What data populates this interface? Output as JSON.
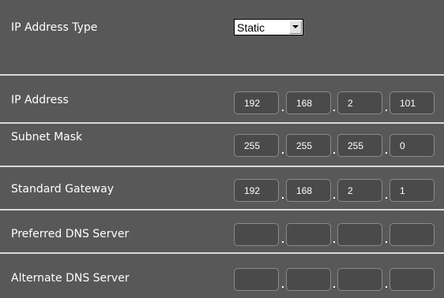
{
  "ip_address_type": {
    "label": "IP Address Type",
    "selected": "Static"
  },
  "fields": [
    {
      "label": "IP Address",
      "octets": [
        "192",
        "168",
        "2",
        "101"
      ]
    },
    {
      "label": "Subnet Mask",
      "octets": [
        "255",
        "255",
        "255",
        "0"
      ]
    },
    {
      "label": "Standard Gateway",
      "octets": [
        "192",
        "168",
        "2",
        "1"
      ]
    },
    {
      "label": "Preferred DNS Server",
      "octets": [
        "",
        "",
        "",
        ""
      ]
    },
    {
      "label": "Alternate DNS Server",
      "octets": [
        "",
        "",
        "",
        ""
      ]
    }
  ]
}
